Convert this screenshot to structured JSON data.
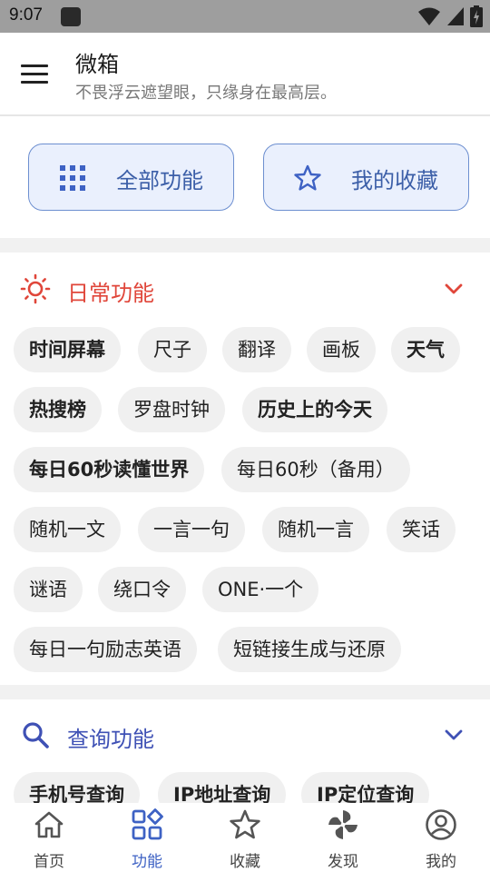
{
  "status_bar": {
    "time": "9:07"
  },
  "header": {
    "title": "微箱",
    "subtitle": "不畏浮云遮望眼，只缘身在最高层。"
  },
  "quick_actions": [
    {
      "label": "全部功能",
      "icon": "grid-icon"
    },
    {
      "label": "我的收藏",
      "icon": "star-icon"
    }
  ],
  "sections": [
    {
      "title": "日常功能",
      "icon": "sun-icon",
      "color": "#e0463a",
      "chips": [
        "时间屏幕",
        "尺子",
        "翻译",
        "画板",
        "天气",
        "热搜榜",
        "罗盘时钟",
        "历史上的今天",
        "每日60秒读懂世界",
        "每日60秒（备用）",
        "随机一文",
        "一言一句",
        "随机一言",
        "笑话",
        "谜语",
        "绕口令",
        "ONE·一个",
        "每日一句励志英语",
        "短链接生成与还原"
      ]
    },
    {
      "title": "查询功能",
      "icon": "search-icon",
      "color": "#3f51b5",
      "chips": [
        "手机号查询",
        "IP地址查询",
        "IP定位查询"
      ]
    }
  ],
  "bottom_nav": [
    {
      "label": "首页",
      "icon": "home-icon"
    },
    {
      "label": "功能",
      "icon": "apps-icon",
      "active": true
    },
    {
      "label": "收藏",
      "icon": "star-outline-icon"
    },
    {
      "label": "发现",
      "icon": "pinwheel-icon"
    },
    {
      "label": "我的",
      "icon": "account-icon"
    }
  ],
  "colors": {
    "accent": "#3e62c4",
    "daily_section": "#e0463a",
    "query_section": "#3f51b5"
  }
}
